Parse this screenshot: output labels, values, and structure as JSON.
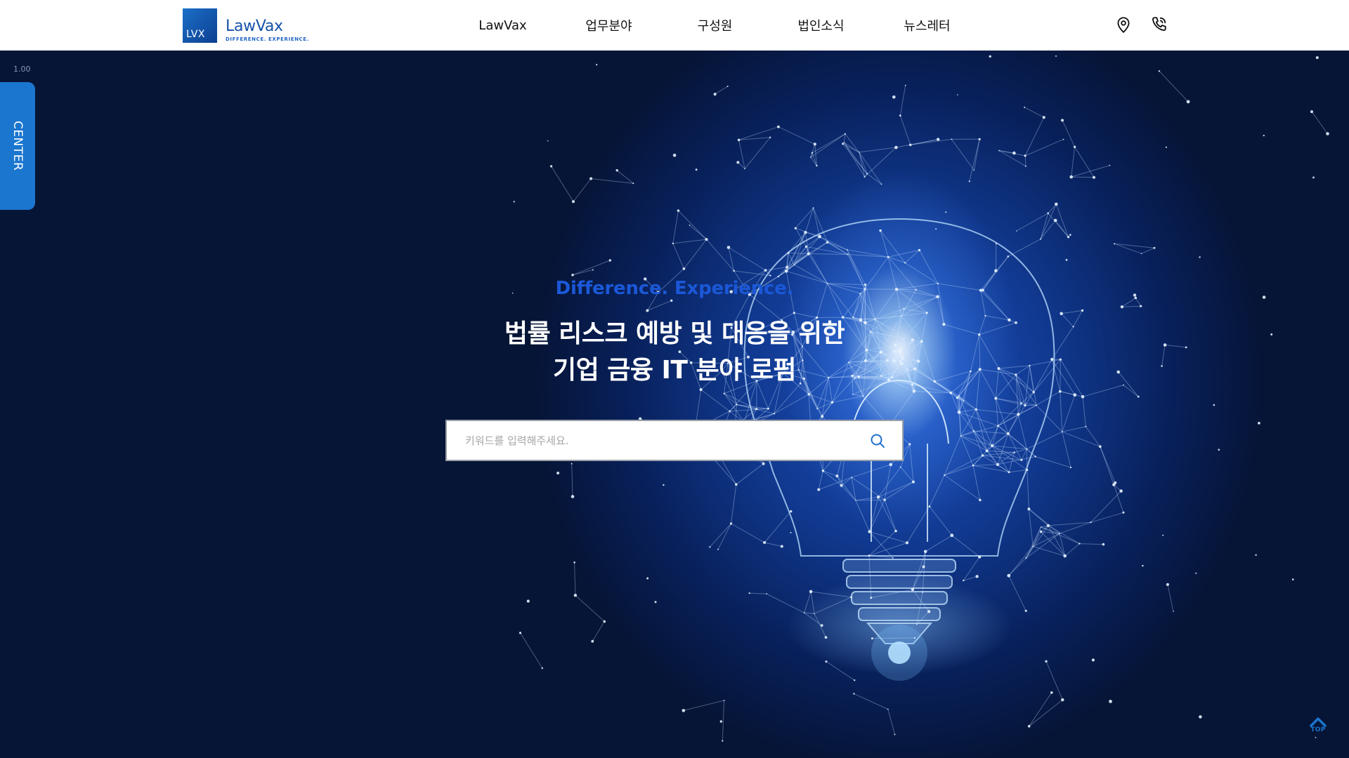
{
  "header": {
    "logo": {
      "mark": "LVX",
      "name": "LawVax",
      "tagline": "DIFFERENCE. EXPERIENCE."
    },
    "nav": [
      {
        "label": "LawVax"
      },
      {
        "label": "업무분야"
      },
      {
        "label": "구성원"
      },
      {
        "label": "법인소식"
      },
      {
        "label": "뉴스레터"
      }
    ],
    "icons": [
      "location-pin-icon",
      "phone-icon"
    ]
  },
  "sidebar": {
    "zoom_level": "1.00",
    "center_tab": "CENTER"
  },
  "hero": {
    "tagline": "Difference. Experience.",
    "headline_line1": "법률 리스크 예방 및 대응을 위한",
    "headline_line2": "기업 금융 IT 분야 로펌",
    "search": {
      "placeholder": "키워드를 입력해주세요.",
      "value": "",
      "icon": "search-icon"
    }
  },
  "top_button": {
    "label": "TOP",
    "icon": "chevron-up-icon"
  },
  "colors": {
    "brand_blue": "#1552a8",
    "accent_blue": "#1b76cf",
    "tagline_blue": "#1b58d8",
    "hero_dark": "#061436"
  }
}
